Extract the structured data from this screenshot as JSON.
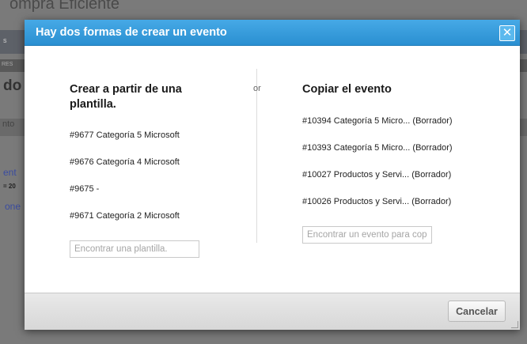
{
  "background": {
    "title": "ompra Eficiente",
    "fragments": [
      "s",
      "RES",
      "do",
      "nto",
      "ent",
      "= 20",
      "one"
    ]
  },
  "modal": {
    "title": "Hay dos formas de crear un evento",
    "close_icon": "✕",
    "divider_label": "or",
    "left": {
      "heading": "Crear a partir de una plantilla.",
      "items": [
        "#9677 Categoría 5 Microsoft",
        "#9676 Categoría 4 Microsoft",
        "#9675 -",
        "#9671 Categoría 2 Microsoft"
      ],
      "search_placeholder": "Encontrar una plantilla."
    },
    "right": {
      "heading": "Copiar el evento",
      "items": [
        {
          "label": "#10394 Categoría 5 Micro...",
          "status": "(Borrador)"
        },
        {
          "label": "#10393 Categoría 5 Micro...",
          "status": "(Borrador)"
        },
        {
          "label": "#10027 Productos y Servi...",
          "status": "(Borrador)"
        },
        {
          "label": "#10026 Productos y Servi...",
          "status": "(Borrador)"
        }
      ],
      "search_placeholder": "Encontrar un evento para copiar"
    },
    "footer": {
      "cancel_label": "Cancelar"
    }
  },
  "colors": {
    "header": "#2a8fd1",
    "overlay": "#6f6f6f"
  }
}
